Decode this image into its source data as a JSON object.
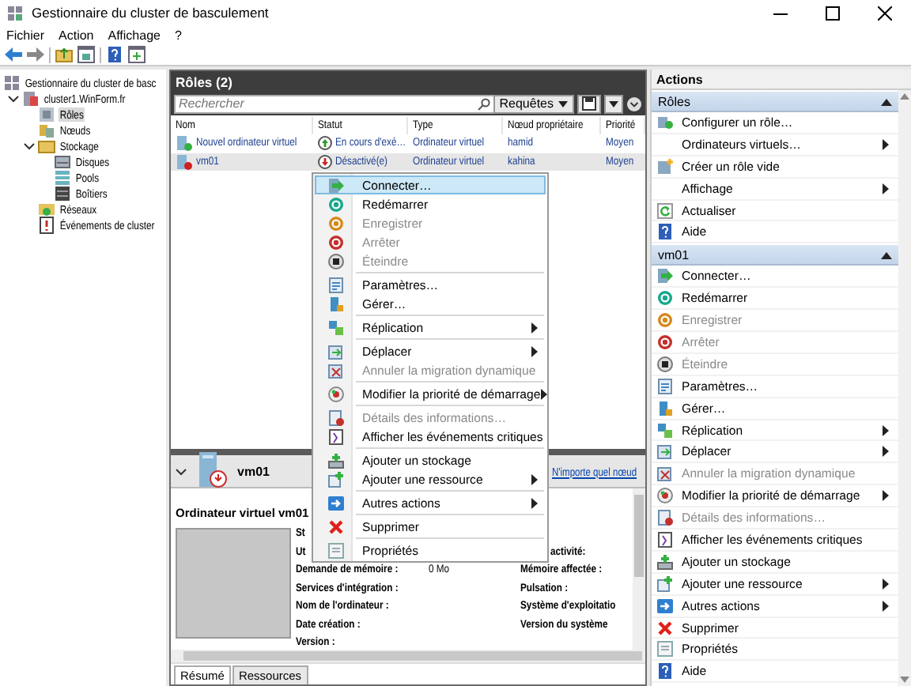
{
  "window": {
    "title": "Gestionnaire du cluster de basculement"
  },
  "menu_bar": [
    "Fichier",
    "Action",
    "Affichage",
    "?"
  ],
  "tree": [
    {
      "label": "Gestionnaire du cluster de basc",
      "selected": false,
      "children": [
        {
          "label": "cluster1.WinForm.fr",
          "selected": false,
          "expanded": true,
          "children": [
            {
              "label": "Rôles",
              "selected": true
            },
            {
              "label": "Nœuds",
              "selected": false
            },
            {
              "label": "Stockage",
              "selected": false,
              "expanded": true,
              "children": [
                {
                  "label": "Disques",
                  "selected": false
                },
                {
                  "label": "Pools",
                  "selected": false
                },
                {
                  "label": "Boîtiers",
                  "selected": false
                }
              ]
            },
            {
              "label": "Réseaux",
              "selected": false
            },
            {
              "label": "Événements de cluster",
              "selected": false
            }
          ]
        }
      ]
    }
  ],
  "roles": {
    "title": "Rôles (2)",
    "search": {
      "placeholder": "Rechercher"
    },
    "queries_button": "Requêtes",
    "columns": [
      "Nom",
      "Statut",
      "Type",
      "Nœud propriétaire",
      "Priorité"
    ],
    "rows": [
      {
        "selected": false,
        "kind": "running",
        "cells": [
          "Nouvel ordinateur virtuel",
          "En cours d'exé…",
          "Ordinateur virtuel",
          "hamid",
          "Moyen"
        ]
      },
      {
        "selected": true,
        "kind": "off",
        "cells": [
          "vm01",
          "Désactivé(e)",
          "Ordinateur virtuel",
          "kahina",
          "Moyen"
        ]
      }
    ]
  },
  "details": {
    "name": "vm01",
    "preferred_node_link": "N'importe quel nœud",
    "title": "Ordinateur virtuel vm01",
    "rows": [
      {
        "label": "St"
      },
      {
        "label": "Ut",
        "right_label": "activité:"
      },
      {
        "label": "Demande de mémoire :",
        "value": "0 Mo",
        "right_label": "Mémoire affectée :"
      },
      {
        "label": "Services d'intégration :",
        "right_label": "Pulsation :"
      },
      {
        "label": "Nom de l'ordinateur :",
        "right_label": "Système d'exploitatio"
      },
      {
        "label": "Date création :",
        "right_label": "Version du système"
      },
      {
        "label": "Version :"
      }
    ],
    "tabs": [
      {
        "label": "Résumé",
        "selected": true
      },
      {
        "label": "Ressources",
        "selected": false
      }
    ]
  },
  "context_menu": {
    "groups": [
      [
        {
          "label": "Connecter…",
          "disabled": false,
          "submenu": false,
          "highlighted": true
        },
        {
          "label": "Redémarrer",
          "disabled": false,
          "submenu": false,
          "highlighted": false
        },
        {
          "label": "Enregistrer",
          "disabled": true,
          "submenu": false,
          "highlighted": false
        },
        {
          "label": "Arrêter",
          "disabled": true,
          "submenu": false,
          "highlighted": false
        },
        {
          "label": "Éteindre",
          "disabled": true,
          "submenu": false,
          "highlighted": false
        }
      ],
      [
        {
          "label": "Paramètres…",
          "disabled": false,
          "submenu": false,
          "highlighted": false
        },
        {
          "label": "Gérer…",
          "disabled": false,
          "submenu": false,
          "highlighted": false
        }
      ],
      [
        {
          "label": "Réplication",
          "disabled": false,
          "submenu": true,
          "highlighted": false
        }
      ],
      [
        {
          "label": "Déplacer",
          "disabled": false,
          "submenu": true,
          "highlighted": false
        },
        {
          "label": "Annuler la migration dynamique",
          "disabled": true,
          "submenu": false,
          "highlighted": false
        }
      ],
      [
        {
          "label": "Modifier la priorité de démarrage",
          "disabled": false,
          "submenu": true,
          "highlighted": false
        }
      ],
      [
        {
          "label": "Détails des informations…",
          "disabled": true,
          "submenu": false,
          "highlighted": false
        },
        {
          "label": "Afficher les événements critiques",
          "disabled": false,
          "submenu": false,
          "highlighted": false
        }
      ],
      [
        {
          "label": "Ajouter un stockage",
          "disabled": false,
          "submenu": false,
          "highlighted": false
        },
        {
          "label": "Ajouter une ressource",
          "disabled": false,
          "submenu": true,
          "highlighted": false
        }
      ],
      [
        {
          "label": "Autres actions",
          "disabled": false,
          "submenu": true,
          "highlighted": false
        }
      ],
      [
        {
          "label": "Supprimer",
          "disabled": false,
          "submenu": false,
          "highlighted": false
        }
      ],
      [
        {
          "label": "Propriétés",
          "disabled": false,
          "submenu": false,
          "highlighted": false
        }
      ]
    ]
  },
  "actions": {
    "title": "Actions",
    "sections": [
      {
        "title": "Rôles",
        "expanded": true,
        "items": [
          {
            "label": "Configurer un rôle…",
            "disabled": false,
            "submenu": false
          },
          {
            "label": "Ordinateurs virtuels…",
            "disabled": false,
            "submenu": true
          },
          {
            "label": "Créer un rôle vide",
            "disabled": false,
            "submenu": false
          },
          {
            "label": "Affichage",
            "disabled": false,
            "submenu": true
          },
          {
            "label": "Actualiser",
            "disabled": false,
            "submenu": false
          },
          {
            "label": "Aide",
            "disabled": false,
            "submenu": false
          }
        ]
      },
      {
        "title": "vm01",
        "expanded": true,
        "items": [
          {
            "label": "Connecter…",
            "disabled": false,
            "submenu": false
          },
          {
            "label": "Redémarrer",
            "disabled": false,
            "submenu": false
          },
          {
            "label": "Enregistrer",
            "disabled": true,
            "submenu": false
          },
          {
            "label": "Arrêter",
            "disabled": true,
            "submenu": false
          },
          {
            "label": "Éteindre",
            "disabled": true,
            "submenu": false
          },
          {
            "label": "Paramètres…",
            "disabled": false,
            "submenu": false
          },
          {
            "label": "Gérer…",
            "disabled": false,
            "submenu": false
          },
          {
            "label": "Réplication",
            "disabled": false,
            "submenu": true
          },
          {
            "label": "Déplacer",
            "disabled": false,
            "submenu": true
          },
          {
            "label": "Annuler la migration dynamique",
            "disabled": true,
            "submenu": false
          },
          {
            "label": "Modifier la priorité de démarrage",
            "disabled": false,
            "submenu": true
          },
          {
            "label": "Détails des informations…",
            "disabled": true,
            "submenu": false
          },
          {
            "label": "Afficher les événements critiques",
            "disabled": false,
            "submenu": false
          },
          {
            "label": "Ajouter un stockage",
            "disabled": false,
            "submenu": false
          },
          {
            "label": "Ajouter une ressource",
            "disabled": false,
            "submenu": true
          },
          {
            "label": "Autres actions",
            "disabled": false,
            "submenu": true
          },
          {
            "label": "Supprimer",
            "disabled": false,
            "submenu": false
          },
          {
            "label": "Propriétés",
            "disabled": false,
            "submenu": false
          },
          {
            "label": "Aide",
            "disabled": false,
            "submenu": false
          }
        ]
      }
    ]
  }
}
